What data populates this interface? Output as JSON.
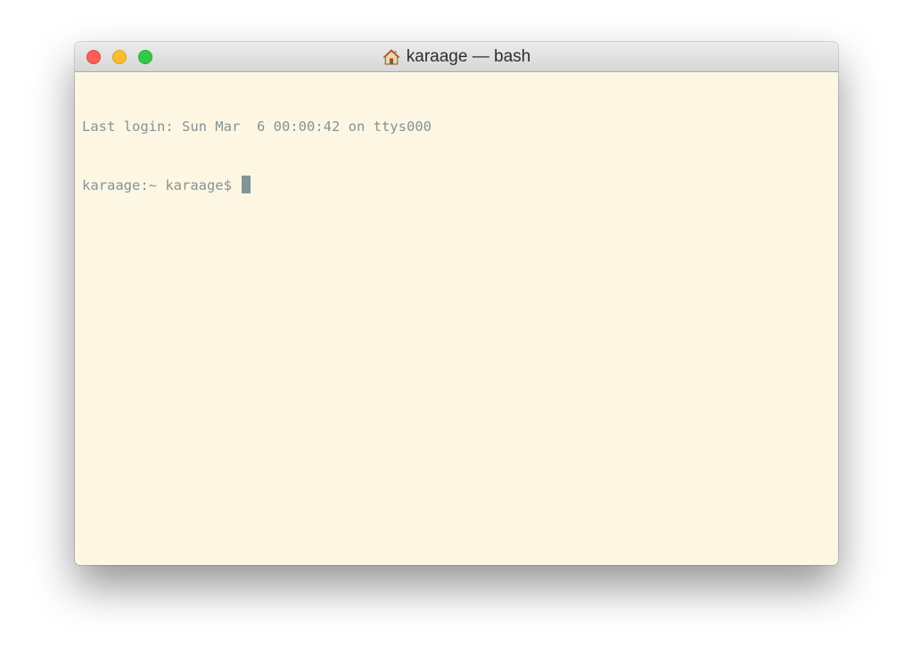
{
  "window": {
    "title": "karaage — bash",
    "icon": "home-icon",
    "background_color": "#fdf6e3",
    "text_color": "#839496"
  },
  "terminal": {
    "lines": [
      "Last login: Sun Mar  6 00:00:42 on ttys000",
      "karaage:~ karaage$ "
    ]
  },
  "traffic_lights": {
    "close_color": "#fc5f57",
    "minimize_color": "#fdbc2e",
    "zoom_color": "#34c84a"
  }
}
